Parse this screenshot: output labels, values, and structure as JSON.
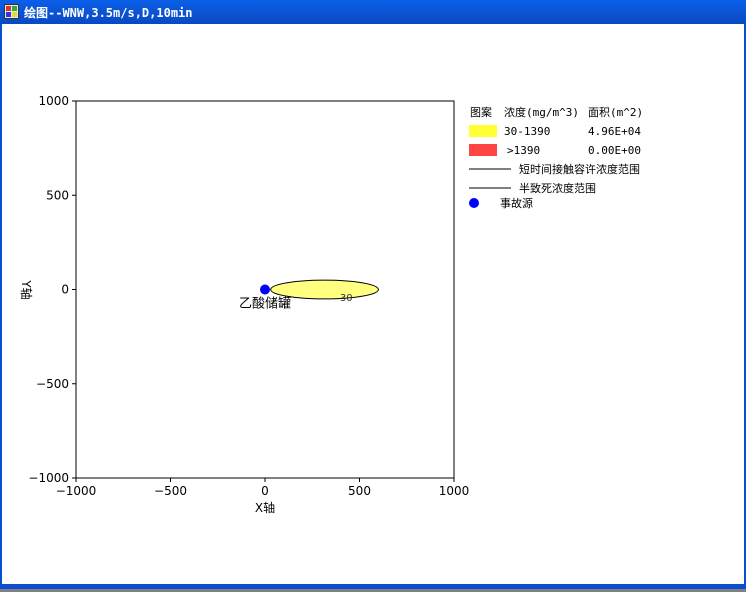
{
  "window": {
    "title": "绘图--WNW,3.5m/s,D,10min"
  },
  "chart_data": {
    "type": "scatter",
    "xlabel": "X轴",
    "ylabel": "Y轴",
    "xlim": [
      -1000,
      1000
    ],
    "ylim": [
      -1000,
      1000
    ],
    "x_ticks": [
      -1000,
      -500,
      0,
      500,
      1000
    ],
    "y_ticks": [
      1000,
      500,
      0,
      -500,
      -1000
    ],
    "grid": false,
    "source": {
      "x": 0,
      "y": 0,
      "label": "乙酸储罐",
      "color": "#0000ff"
    },
    "plume": {
      "x_start": 30,
      "x_end": 600,
      "half_width": 50,
      "contour_label": "30",
      "color": "#ffff80"
    }
  },
  "legend": {
    "header_pattern": "图案",
    "header_conc": "浓度(mg/m^3)",
    "header_area": "面积(m^2)",
    "rows": [
      {
        "color": "#ffff33",
        "range": "30-1390",
        "area": "4.96E+04"
      },
      {
        "color": "#ff4444",
        "range": ">1390",
        "area": "0.00E+00"
      }
    ],
    "line1": "短时间接触容许浓度范围",
    "line2": "半致死浓度范围",
    "source_label": "事故源"
  }
}
